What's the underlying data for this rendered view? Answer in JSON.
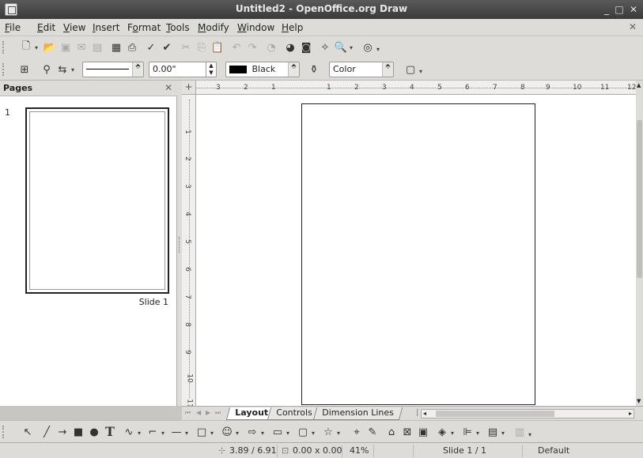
{
  "window": {
    "title": "Untitled2 - OpenOffice.org Draw"
  },
  "menu": {
    "items": [
      {
        "u": "F",
        "rest": "ile"
      },
      {
        "u": "E",
        "rest": "dit"
      },
      {
        "u": "V",
        "rest": "iew"
      },
      {
        "u": "I",
        "rest": "nsert"
      },
      {
        "pre": "F",
        "u": "o",
        "rest": "rmat"
      },
      {
        "u": "T",
        "rest": "ools"
      },
      {
        "u": "M",
        "rest": "odify"
      },
      {
        "u": "W",
        "rest": "indow"
      },
      {
        "u": "H",
        "rest": "elp"
      }
    ]
  },
  "line_toolbar": {
    "width_value": "0.00\"",
    "line_color": "Black",
    "line_color_swatch": "#000000",
    "area_style": "Color"
  },
  "pages_pane": {
    "title": "Pages",
    "page_number": "1",
    "slide_label": "Slide 1"
  },
  "rulers": {
    "horizontal": [
      "3",
      "2",
      "1",
      "1",
      "2",
      "3",
      "4",
      "5",
      "6",
      "7",
      "8",
      "9",
      "10",
      "11",
      "12"
    ],
    "vertical": [
      "1",
      "2",
      "3",
      "4",
      "5",
      "6",
      "7",
      "8",
      "9",
      "10",
      "11"
    ]
  },
  "tabs": [
    {
      "label": "Layout",
      "active": true
    },
    {
      "label": "Controls",
      "active": false
    },
    {
      "label": "Dimension Lines",
      "active": false
    }
  ],
  "status": {
    "position": "3.89 / 6.91",
    "size": "0.00 x 0.00",
    "zoom": "41%",
    "slide": "Slide 1 / 1",
    "layout": "Default"
  },
  "icons": {
    "standard": [
      "new-icon",
      "open-icon",
      "save-icon",
      "email-icon",
      "edit-file-icon",
      "export-pdf-icon",
      "print-icon",
      "spellcheck-icon",
      "autospell-icon",
      "cut-icon",
      "copy-icon",
      "paste-icon",
      "undo-icon",
      "redo-icon",
      "chart-icon",
      "effects-icon",
      "gallery-icon",
      "navigator-icon",
      "zoom-icon",
      "help-icon"
    ],
    "drawing": [
      "select-icon",
      "line-icon",
      "arrow-icon",
      "rectangle-icon",
      "ellipse-icon",
      "text-icon",
      "curve-icon",
      "connector-icon",
      "line-arrow-icon",
      "basic-shapes-icon",
      "symbol-shapes-icon",
      "block-arrows-icon",
      "flowchart-icon",
      "callouts-icon",
      "stars-icon",
      "points-icon",
      "glue-points-icon",
      "fontwork-icon",
      "from-file-icon",
      "gallery-icon",
      "extrusion-icon",
      "align-icon",
      "arrange-icon",
      "shadow-icon"
    ]
  }
}
